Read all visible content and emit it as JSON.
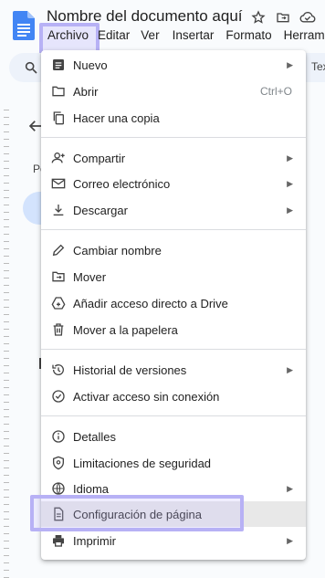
{
  "document": {
    "title": "Nombre del documento aquí"
  },
  "menubar": {
    "items": [
      "Archivo",
      "Editar",
      "Ver",
      "Insertar",
      "Formato",
      "Herramientas"
    ]
  },
  "toolbar": {
    "partial_text": "Tex"
  },
  "sidebar": {
    "partial_text": "Pe"
  },
  "file_menu": {
    "items": [
      {
        "label": "Nuevo",
        "icon": "new-doc-icon",
        "submenu": true
      },
      {
        "label": "Abrir",
        "icon": "folder-icon",
        "shortcut": "Ctrl+O"
      },
      {
        "label": "Hacer una copia",
        "icon": "copy-icon"
      },
      {
        "label": "Compartir",
        "icon": "person-add-icon",
        "submenu": true
      },
      {
        "label": "Correo electrónico",
        "icon": "mail-icon",
        "submenu": true
      },
      {
        "label": "Descargar",
        "icon": "download-icon",
        "submenu": true
      },
      {
        "label": "Cambiar nombre",
        "icon": "pencil-icon"
      },
      {
        "label": "Mover",
        "icon": "move-folder-icon"
      },
      {
        "label": "Añadir acceso directo a Drive",
        "icon": "drive-shortcut-icon"
      },
      {
        "label": "Mover a la papelera",
        "icon": "trash-icon"
      },
      {
        "label": "Historial de versiones",
        "icon": "history-icon",
        "submenu": true
      },
      {
        "label": "Activar acceso sin conexión",
        "icon": "offline-check-icon"
      },
      {
        "label": "Detalles",
        "icon": "info-icon"
      },
      {
        "label": "Limitaciones de seguridad",
        "icon": "shield-icon"
      },
      {
        "label": "Idioma",
        "icon": "globe-icon",
        "submenu": true
      },
      {
        "label": "Configuración de página",
        "icon": "page-setup-icon",
        "active": true
      },
      {
        "label": "Imprimir",
        "icon": "printer-icon",
        "submenu": true
      }
    ]
  },
  "colors": {
    "highlight": "#b7b1f5",
    "active_row": "#e8e8e8",
    "docs_blue": "#4285f4"
  }
}
